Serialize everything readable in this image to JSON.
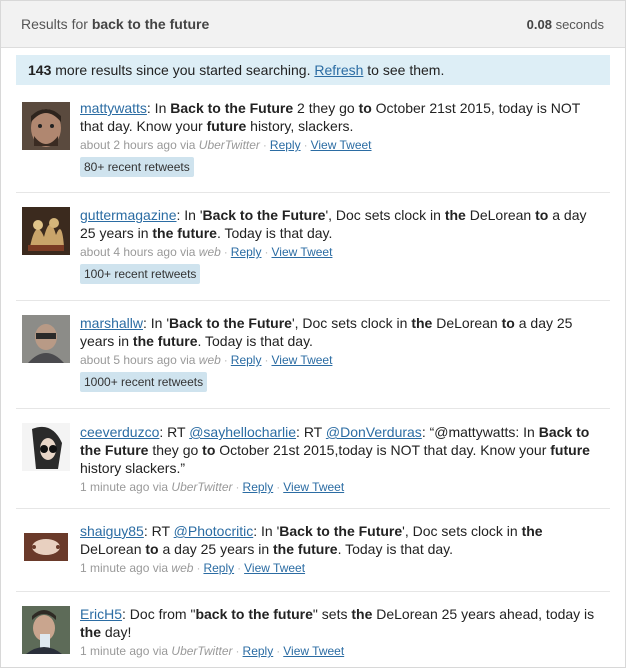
{
  "header": {
    "prefix": "Results for",
    "query": "back to the future",
    "time_value": "0.08",
    "time_unit": "seconds"
  },
  "notice": {
    "count": "143",
    "text": " more results since you started searching. ",
    "refresh_label": "Refresh",
    "suffix": " to see them."
  },
  "tweets": [
    {
      "user": "mattywatts",
      "time": "about 2 hours ago",
      "via_prefix": "via",
      "source": "UberTwitter",
      "reply": "Reply",
      "view": "View Tweet",
      "retweets": "80+ recent retweets"
    },
    {
      "user": "guttermagazine",
      "time": "about 4 hours ago",
      "via_prefix": "via",
      "source": "web",
      "reply": "Reply",
      "view": "View Tweet",
      "retweets": "100+ recent retweets"
    },
    {
      "user": "marshallw",
      "time": "about 5 hours ago",
      "via_prefix": "via",
      "source": "web",
      "reply": "Reply",
      "view": "View Tweet",
      "retweets": "1000+ recent retweets"
    },
    {
      "user": "ceeverduzco",
      "mention1": "@sayhellocharlie",
      "mention2": "@DonVerduras",
      "time": "1 minute ago",
      "via_prefix": "via",
      "source": "UberTwitter",
      "reply": "Reply",
      "view": "View Tweet"
    },
    {
      "user": "shaiguy85",
      "mention1": "@Photocritic",
      "time": "1 minute ago",
      "via_prefix": "via",
      "source": "web",
      "reply": "Reply",
      "view": "View Tweet"
    },
    {
      "user": "EricH5",
      "time": "1 minute ago",
      "via_prefix": "via",
      "source": "UberTwitter",
      "reply": "Reply",
      "view": "View Tweet"
    }
  ],
  "tweet_text": {
    "t0": {
      "a": ": In ",
      "b": "Back to the Future",
      "c": " 2 they go ",
      "d": "to",
      "e": " October 21st 2015, today is NOT that day. Know your ",
      "f": "future",
      "g": " history, slackers."
    },
    "t1": {
      "a": ": In '",
      "b": "Back to the Future",
      "c": "', Doc sets clock in ",
      "d": "the",
      "e": " DeLorean ",
      "f": "to",
      "g": " a day 25 years in ",
      "h": "the future",
      "i": ". Today is that day."
    },
    "t2": {
      "a": ": In '",
      "b": "Back to the Future",
      "c": "', Doc sets clock in ",
      "d": "the",
      "e": " DeLorean ",
      "f": "to",
      "g": " a day 25 years in ",
      "h": "the future",
      "i": ". Today is that day."
    },
    "t3": {
      "a": ": RT ",
      "b": ": RT ",
      "c": ": “@mattywatts: In ",
      "d": "Back to the Future",
      "e": " they go ",
      "f": "to",
      "g": " October 21st 2015,today is NOT that day. Know your ",
      "h": "future",
      "i": " history slackers.”"
    },
    "t4": {
      "a": ": RT ",
      "b": ": In '",
      "c": "Back to the Future",
      "d": "', Doc sets clock in ",
      "e": "the",
      "f": " DeLorean ",
      "g": "to",
      "h": " a day 25 years in ",
      "i": "the future",
      "j": ". Today is that day."
    },
    "t5": {
      "a": ": Doc from \"",
      "b": "back to the future",
      "c": "\" sets ",
      "d": "the",
      "e": " DeLorean 25 years ahead, today is ",
      "f": "the",
      "g": " day!"
    }
  },
  "colors": {
    "link": "#2b6ca3",
    "notice_bg": "#ddeef6",
    "badge_bg": "#cfe3ee",
    "header_bg": "#f2f2f2"
  }
}
